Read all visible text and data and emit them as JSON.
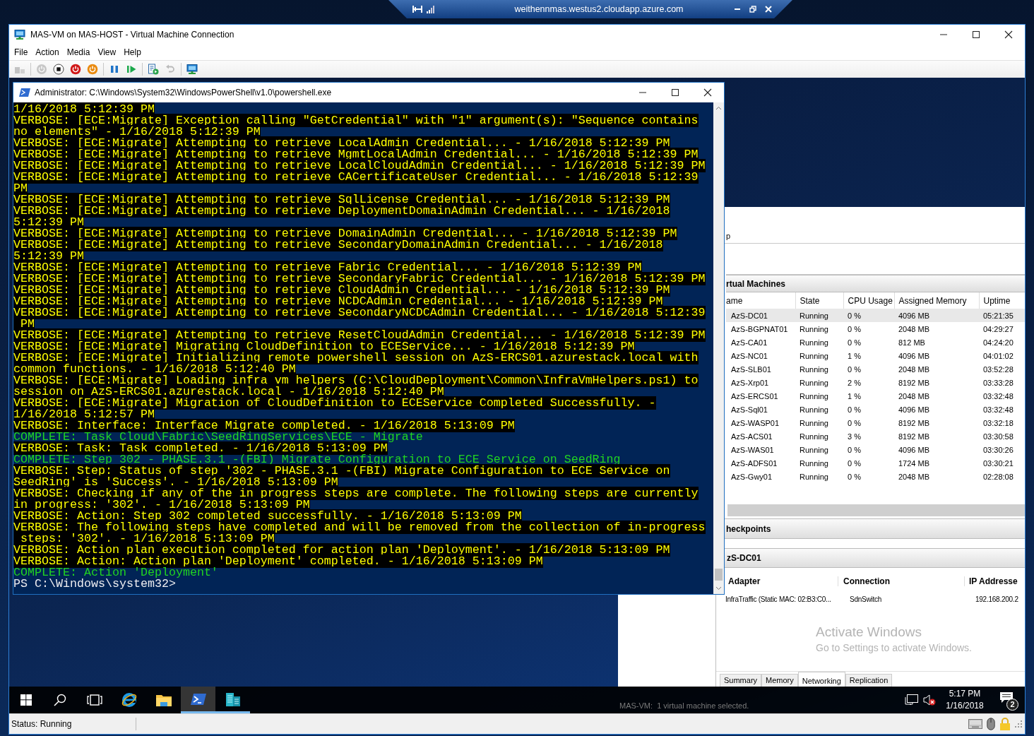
{
  "rdp_bar": {
    "title": "weithennmas.westus2.cloudapp.azure.com"
  },
  "window": {
    "title": "MAS-VM on MAS-HOST - Virtual Machine Connection",
    "menu": [
      "File",
      "Action",
      "Media",
      "View",
      "Help"
    ],
    "toolbar": [
      {
        "kind": "ctrl_alt_del",
        "disabled": true
      },
      {
        "kind": "start",
        "disabled": true
      },
      {
        "kind": "turn_off",
        "disabled": false
      },
      {
        "kind": "shut_down",
        "disabled": false
      },
      {
        "kind": "save",
        "disabled": false
      },
      {
        "kind": "pause",
        "disabled": false
      },
      {
        "kind": "reset",
        "disabled": false
      },
      {
        "kind": "checkpoint",
        "disabled": false
      },
      {
        "kind": "revert",
        "disabled": true
      },
      {
        "kind": "enhanced_session",
        "disabled": false
      }
    ],
    "status": "Status: Running"
  },
  "powershell": {
    "title": "Administrator: C:\\Windows\\System32\\WindowsPowerShell\\v1.0\\powershell.exe",
    "lines": [
      {
        "kind": "verbose",
        "text": "1/16/2018 5:12:39 PM"
      },
      {
        "kind": "verbose",
        "text": "VERBOSE: [ECE:Migrate] Exception calling \"GetCredential\" with \"1\" argument(s): \"Sequence contains"
      },
      {
        "kind": "verbose",
        "text": "no elements\" - 1/16/2018 5:12:39 PM"
      },
      {
        "kind": "verbose",
        "text": "VERBOSE: [ECE:Migrate] Attempting to retrieve LocalAdmin Credential... - 1/16/2018 5:12:39 PM"
      },
      {
        "kind": "verbose",
        "text": "VERBOSE: [ECE:Migrate] Attempting to retrieve MgmtLocalAdmin Credential... - 1/16/2018 5:12:39 PM"
      },
      {
        "kind": "verbose",
        "text": "VERBOSE: [ECE:Migrate] Attempting to retrieve LocalCloudAdmin Credential... - 1/16/2018 5:12:39 PM"
      },
      {
        "kind": "verbose",
        "text": "VERBOSE: [ECE:Migrate] Attempting to retrieve CACertificateUser Credential... - 1/16/2018 5:12:39"
      },
      {
        "kind": "verbose",
        "text": "PM"
      },
      {
        "kind": "verbose",
        "text": "VERBOSE: [ECE:Migrate] Attempting to retrieve SqlLicense Credential... - 1/16/2018 5:12:39 PM"
      },
      {
        "kind": "verbose",
        "text": "VERBOSE: [ECE:Migrate] Attempting to retrieve DeploymentDomainAdmin Credential... - 1/16/2018"
      },
      {
        "kind": "verbose",
        "text": "5:12:39 PM"
      },
      {
        "kind": "verbose",
        "text": "VERBOSE: [ECE:Migrate] Attempting to retrieve DomainAdmin Credential... - 1/16/2018 5:12:39 PM"
      },
      {
        "kind": "verbose",
        "text": "VERBOSE: [ECE:Migrate] Attempting to retrieve SecondaryDomainAdmin Credential... - 1/16/2018"
      },
      {
        "kind": "verbose",
        "text": "5:12:39 PM"
      },
      {
        "kind": "verbose",
        "text": "VERBOSE: [ECE:Migrate] Attempting to retrieve Fabric Credential... - 1/16/2018 5:12:39 PM"
      },
      {
        "kind": "verbose",
        "text": "VERBOSE: [ECE:Migrate] Attempting to retrieve SecondaryFabric Credential... - 1/16/2018 5:12:39 PM"
      },
      {
        "kind": "verbose",
        "text": "VERBOSE: [ECE:Migrate] Attempting to retrieve CloudAdmin Credential... - 1/16/2018 5:12:39 PM"
      },
      {
        "kind": "verbose",
        "text": "VERBOSE: [ECE:Migrate] Attempting to retrieve NCDCAdmin Credential... - 1/16/2018 5:12:39 PM"
      },
      {
        "kind": "verbose",
        "text": "VERBOSE: [ECE:Migrate] Attempting to retrieve SecondaryNCDCAdmin Credential... - 1/16/2018 5:12:39"
      },
      {
        "kind": "verbose",
        "text": " PM"
      },
      {
        "kind": "verbose",
        "text": "VERBOSE: [ECE:Migrate] Attempting to retrieve ResetCloudAdmin Credential... - 1/16/2018 5:12:39 PM"
      },
      {
        "kind": "verbose",
        "text": "VERBOSE: [ECE:Migrate] Migrating CloudDefinition to ECEService... - 1/16/2018 5:12:39 PM"
      },
      {
        "kind": "verbose",
        "text": "VERBOSE: [ECE:Migrate] Initializing remote powershell session on AzS-ERCS01.azurestack.local with"
      },
      {
        "kind": "verbose",
        "text": "common functions. - 1/16/2018 5:12:40 PM"
      },
      {
        "kind": "verbose",
        "text": "VERBOSE: [ECE:Migrate] Loading infra vm helpers (C:\\CloudDeployment\\Common\\InfraVmHelpers.ps1) to"
      },
      {
        "kind": "verbose",
        "text": "session on AzS-ERCS01.azurestack.local - 1/16/2018 5:12:40 PM"
      },
      {
        "kind": "verbose",
        "text": "VERBOSE: [ECE:Migrate] Migration of CloudDefinition to ECEService Completed Successfully. -"
      },
      {
        "kind": "verbose",
        "text": "1/16/2018 5:12:57 PM"
      },
      {
        "kind": "verbose",
        "text": "VERBOSE: Interface: Interface Migrate completed. - 1/16/2018 5:13:09 PM"
      },
      {
        "kind": "complete",
        "text": "COMPLETE: Task Cloud\\Fabric\\SeedRingServices\\ECE - Migrate"
      },
      {
        "kind": "verbose",
        "text": "VERBOSE: Task: Task completed. - 1/16/2018 5:13:09 PM"
      },
      {
        "kind": "complete",
        "text": "COMPLETE: Step 302 - PHASE.3.1 -(FBI) Migrate Configuration to ECE Service on SeedRing"
      },
      {
        "kind": "verbose",
        "text": "VERBOSE: Step: Status of step '302 - PHASE.3.1 -(FBI) Migrate Configuration to ECE Service on"
      },
      {
        "kind": "verbose",
        "text": "SeedRing' is 'Success'. - 1/16/2018 5:13:09 PM"
      },
      {
        "kind": "verbose",
        "text": "VERBOSE: Checking if any of the in progress steps are complete. The following steps are currently"
      },
      {
        "kind": "verbose",
        "text": "in progress: '302'. - 1/16/2018 5:13:09 PM"
      },
      {
        "kind": "verbose",
        "text": "VERBOSE: Action: Step 302 completed successfully. - 1/16/2018 5:13:09 PM"
      },
      {
        "kind": "verbose",
        "text": "VERBOSE: The following steps have completed and will be removed from the collection of in-progress"
      },
      {
        "kind": "verbose",
        "text": " steps: '302'. - 1/16/2018 5:13:09 PM"
      },
      {
        "kind": "verbose",
        "text": "VERBOSE: Action plan execution completed for action plan 'Deployment'. - 1/16/2018 5:13:09 PM"
      },
      {
        "kind": "verbose",
        "text": "VERBOSE: Action: Action plan 'Deployment' completed. - 1/16/2018 5:13:09 PM"
      },
      {
        "kind": "complete",
        "text": "COMPLETE: Action 'Deployment'"
      },
      {
        "kind": "prompt",
        "text": "PS C:\\Windows\\system32>"
      }
    ]
  },
  "hyperv_manager": {
    "upper_fragment": "p",
    "vm_section": "rtual Machines",
    "columns": [
      "ame",
      "State",
      "CPU Usage",
      "Assigned Memory",
      "Uptime"
    ],
    "rows": [
      {
        "name": "AzS-DC01",
        "state": "Running",
        "cpu": "0 %",
        "memory": "4096 MB",
        "uptime": "05:21:35",
        "selected": true
      },
      {
        "name": "AzS-BGPNAT01",
        "state": "Running",
        "cpu": "0 %",
        "memory": "2048 MB",
        "uptime": "04:29:27",
        "selected": false
      },
      {
        "name": "AzS-CA01",
        "state": "Running",
        "cpu": "0 %",
        "memory": "812 MB",
        "uptime": "04:24:20",
        "selected": false
      },
      {
        "name": "AzS-NC01",
        "state": "Running",
        "cpu": "1 %",
        "memory": "4096 MB",
        "uptime": "04:01:02",
        "selected": false
      },
      {
        "name": "AzS-SLB01",
        "state": "Running",
        "cpu": "0 %",
        "memory": "2048 MB",
        "uptime": "03:52:28",
        "selected": false
      },
      {
        "name": "AzS-Xrp01",
        "state": "Running",
        "cpu": "2 %",
        "memory": "8192 MB",
        "uptime": "03:33:28",
        "selected": false
      },
      {
        "name": "AzS-ERCS01",
        "state": "Running",
        "cpu": "1 %",
        "memory": "2048 MB",
        "uptime": "03:32:48",
        "selected": false
      },
      {
        "name": "AzS-Sql01",
        "state": "Running",
        "cpu": "0 %",
        "memory": "4096 MB",
        "uptime": "03:32:48",
        "selected": false
      },
      {
        "name": "AzS-WASP01",
        "state": "Running",
        "cpu": "0 %",
        "memory": "8192 MB",
        "uptime": "03:32:18",
        "selected": false
      },
      {
        "name": "AzS-ACS01",
        "state": "Running",
        "cpu": "3 %",
        "memory": "8192 MB",
        "uptime": "03:30:58",
        "selected": false
      },
      {
        "name": "AzS-WAS01",
        "state": "Running",
        "cpu": "0 %",
        "memory": "4096 MB",
        "uptime": "03:30:26",
        "selected": false
      },
      {
        "name": "AzS-ADFS01",
        "state": "Running",
        "cpu": "0 %",
        "memory": "1724 MB",
        "uptime": "03:30:21",
        "selected": false
      },
      {
        "name": "AzS-Gwy01",
        "state": "Running",
        "cpu": "0 %",
        "memory": "2048 MB",
        "uptime": "02:28:08",
        "selected": false
      }
    ],
    "checkpoints_section": "heckpoints",
    "details_title": "zS-DC01",
    "network_columns": [
      "Adapter",
      "Connection",
      "IP Addresse"
    ],
    "network_rows": [
      {
        "adapter": "InfraTraffic (Static MAC: 02:B3:C0...",
        "connection": "SdnSwitch",
        "ip": "192.168.200.2"
      }
    ],
    "tabs": [
      {
        "label": "Summary",
        "selected": false
      },
      {
        "label": "Memory",
        "selected": false
      },
      {
        "label": "Networking",
        "selected": true
      },
      {
        "label": "Replication",
        "selected": false
      }
    ],
    "status": "MAS-VM:  1 virtual machine selected."
  },
  "activation_notice": {
    "title": "Activate Windows",
    "message": "Go to Settings to activate Windows."
  },
  "taskbar": {
    "apps": [
      {
        "kind": "ie",
        "running": false,
        "active": false
      },
      {
        "kind": "explorer",
        "running": false,
        "active": false
      },
      {
        "kind": "powershell",
        "running": true,
        "active": true
      },
      {
        "kind": "server_manager",
        "running": true,
        "active": false
      }
    ],
    "volume_muted": true,
    "time": "5:17 PM",
    "date": "1/16/2018",
    "notification_count": "2"
  }
}
